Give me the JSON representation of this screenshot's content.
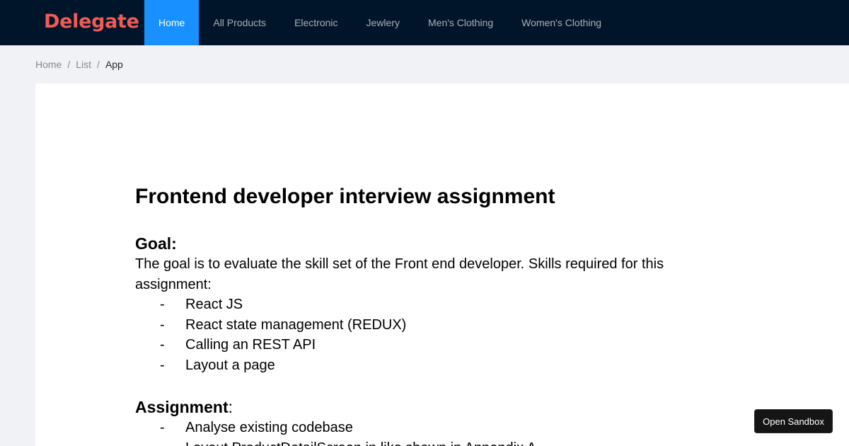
{
  "header": {
    "logo": "Delegate",
    "nav": [
      {
        "label": "Home",
        "active": true
      },
      {
        "label": "All Products",
        "active": false
      },
      {
        "label": "Electronic",
        "active": false
      },
      {
        "label": "Jewlery",
        "active": false
      },
      {
        "label": "Men's Clothing",
        "active": false
      },
      {
        "label": "Women's Clothing",
        "active": false
      }
    ]
  },
  "breadcrumb": {
    "items": [
      "Home",
      "List",
      "App"
    ],
    "separator": "/"
  },
  "document": {
    "title": "Frontend developer interview assignment",
    "goal": {
      "heading": "Goal:",
      "text": "The goal is to evaluate the skill set of the Front end developer. Skills required for this assignment:",
      "bullets": [
        "React JS",
        "React state management (REDUX)",
        "Calling an REST API",
        "Layout a page"
      ]
    },
    "assignment": {
      "heading": "Assignment",
      "heading_suffix": ":",
      "bullets": [
        "Analyse existing codebase",
        "Layout ProductDetailScreen in like shown in Appendix A"
      ]
    },
    "bullet_marker": "-"
  },
  "sandbox_button": {
    "label": "Open Sandbox"
  },
  "colors": {
    "header_bg": "#001529",
    "logo": "#f05b56",
    "active_nav": "#1890ff",
    "page_bg": "#f0f2f5"
  }
}
